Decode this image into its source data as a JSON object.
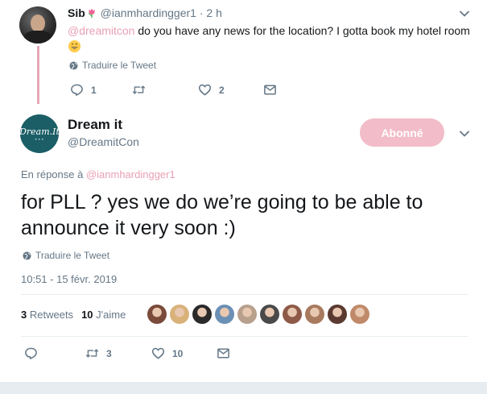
{
  "reply_tweet": {
    "name": "Sib",
    "name_emoji": "tulip-emoji",
    "handle": "@ianmhardingger1",
    "separator": "·",
    "time": "2 h",
    "mention": "@dreamitcon",
    "text": " do you have any news for the location? I gotta book my hotel room ",
    "emoji": "grinning-face-emoji",
    "translate": "Traduire le Tweet",
    "actions": {
      "reply": "1",
      "retweet": "",
      "like": "2"
    }
  },
  "main_tweet": {
    "name": "Dream it",
    "handle": "@DreamitCon",
    "avatar_text": "Dream.It",
    "follow_label": "Abonné",
    "reply_prefix": "En réponse à ",
    "reply_mention": "@ianmhardingger1",
    "text": "for PLL ? yes we do we’re going to be able to announce it very soon :)",
    "translate": "Traduire le Tweet",
    "timestamp": "10:51 - 15 févr. 2019",
    "stats": {
      "retweets_count": "3",
      "retweets_label": "Retweets",
      "likes_count": "10",
      "likes_label": "J'aime"
    },
    "actions": {
      "reply": "",
      "retweet": "3",
      "like": "10"
    }
  },
  "colors": {
    "accent_pink": "#e8a0b4",
    "follow_button": "#f2bcc8",
    "muted_text": "#657786",
    "brand_avatar": "#1b5e66",
    "thread_line": "#e6a8b8"
  },
  "likers": [
    {
      "name": "liker-1",
      "color": "#7a4a3a"
    },
    {
      "name": "liker-2",
      "color": "#d9b27a"
    },
    {
      "name": "liker-3",
      "color": "#2a2a2a"
    },
    {
      "name": "liker-4",
      "color": "#6b8fb5"
    },
    {
      "name": "liker-5",
      "color": "#b7a08c"
    },
    {
      "name": "liker-6",
      "color": "#4a4a4a"
    },
    {
      "name": "liker-7",
      "color": "#8e5a48"
    },
    {
      "name": "liker-8",
      "color": "#a87a5e"
    },
    {
      "name": "liker-9",
      "color": "#5a3a30"
    },
    {
      "name": "liker-10",
      "color": "#c08a6a"
    }
  ]
}
